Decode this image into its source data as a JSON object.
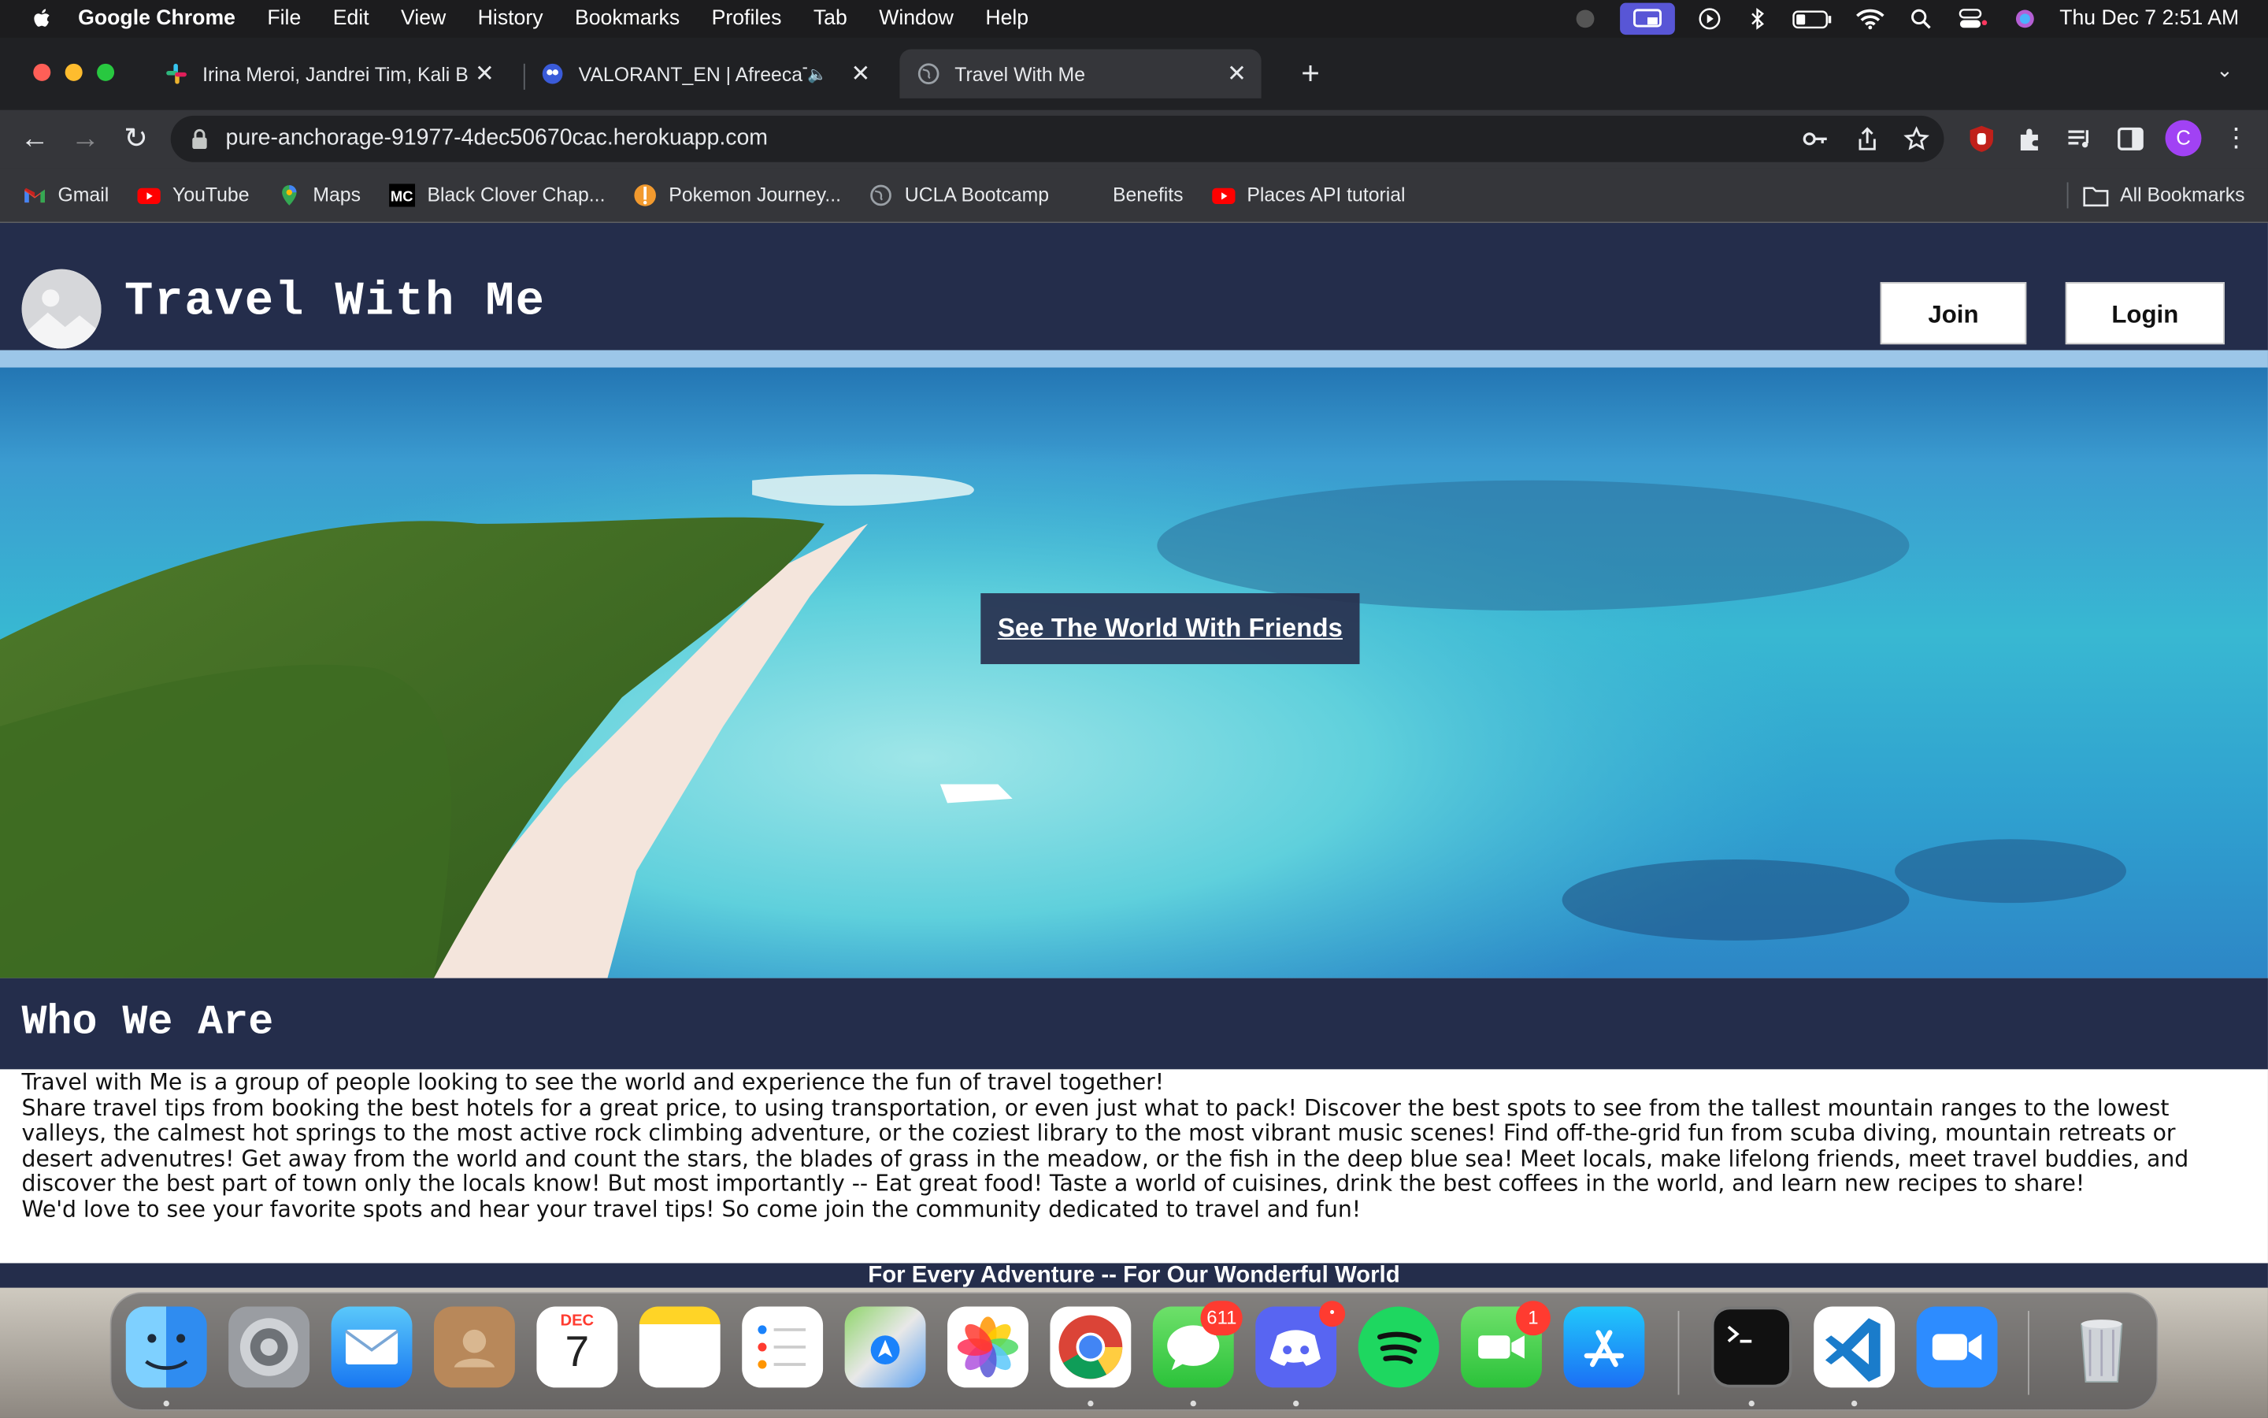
{
  "menubar": {
    "app": "Google Chrome",
    "items": [
      "File",
      "Edit",
      "View",
      "History",
      "Bookmarks",
      "Profiles",
      "Tab",
      "Window",
      "Help"
    ],
    "clock": "Thu Dec 7  2:51 AM"
  },
  "tabs": [
    {
      "title": "Irina Meroi, Jandrei Tim, Kali B",
      "icon": "slack-icon"
    },
    {
      "title": "VALORANT_EN | AfreecaT",
      "icon": "afreeca-icon"
    },
    {
      "title": "Travel With Me",
      "icon": "globe-icon",
      "active": true
    }
  ],
  "address": {
    "url": "pure-anchorage-91977-4dec50670cac.herokuapp.com"
  },
  "profile_initial": "C",
  "bookmarks": [
    {
      "label": "Gmail",
      "icon": "gmail-icon"
    },
    {
      "label": "YouTube",
      "icon": "youtube-icon"
    },
    {
      "label": "Maps",
      "icon": "maps-icon"
    },
    {
      "label": "Black Clover Chap...",
      "icon": "mc-icon"
    },
    {
      "label": "Pokemon Journey...",
      "icon": "pokemon-icon"
    },
    {
      "label": "UCLA Bootcamp",
      "icon": "globe-icon"
    },
    {
      "label": "Benefits",
      "icon": ""
    },
    {
      "label": "Places API tutorial",
      "icon": "youtube-icon"
    }
  ],
  "all_bookmarks": "All Bookmarks",
  "site": {
    "title": "Travel With Me",
    "join": "Join",
    "login": "Login",
    "hero_cta": "See The World With Friends",
    "who_heading": "Who We Are",
    "about": [
      "Travel with Me is a group of people looking to see the world and experience the fun of travel together!",
      "Share travel tips from booking the best hotels for a great price, to using transportation, or even just what to pack! Discover the best spots to see from the tallest mountain ranges to the lowest valleys, the calmest hot springs to the most active rock climbing adventure, or the coziest library to the most vibrant music scenes! Find off-the-grid fun from scuba diving, mountain retreats or desert advenutres! Get away from the world and count the stars, the blades of grass in the meadow, or the fish in the deep blue sea! Meet locals, make lifelong friends, meet travel buddies, and discover the best part of town only the locals know! But most importantly -- Eat great food! Taste a world of cuisines, drink the best coffees in the world, and learn new recipes to share!",
      "We'd love to see your favorite spots and hear your travel tips! So come join the community dedicated to travel and fun!"
    ],
    "footer": "For Every Adventure -- For Our Wonderful World"
  },
  "dock": {
    "calendar_month": "DEC",
    "calendar_day": "7",
    "messages_badge": "611",
    "facetime_badge": "1"
  }
}
